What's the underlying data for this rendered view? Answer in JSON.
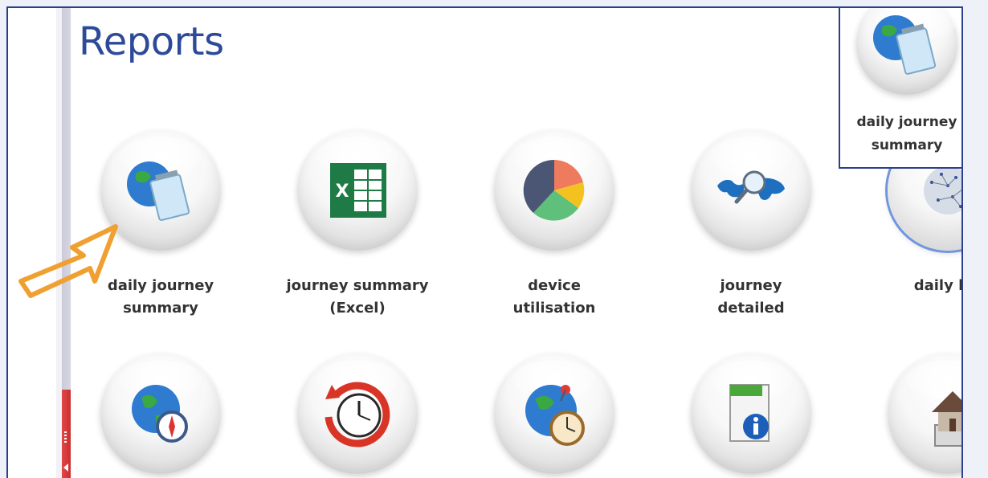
{
  "page": {
    "title": "Reports"
  },
  "reports_row1": [
    {
      "label_line1": "daily journey",
      "label_line2": "summary",
      "icon": "globe-notepad-icon"
    },
    {
      "label_line1": "journey summary",
      "label_line2": "(Excel)",
      "icon": "excel-icon"
    },
    {
      "label_line1": "device",
      "label_line2": "utilisation",
      "icon": "pie-chart-icon"
    },
    {
      "label_line1": "journey",
      "label_line2": "detailed",
      "icon": "world-map-magnifier-icon"
    },
    {
      "label_line1": "daily loc",
      "label_line2": "",
      "icon": "network-globe-icon"
    }
  ],
  "reports_row2": [
    {
      "icon": "globe-compass-icon"
    },
    {
      "icon": "clock-refresh-icon"
    },
    {
      "icon": "globe-pin-clock-icon"
    },
    {
      "icon": "document-info-icon"
    },
    {
      "icon": "house-calculator-icon"
    }
  ],
  "tooltip": {
    "label_line1": "daily journey",
    "label_line2": "summary",
    "icon": "globe-notepad-icon"
  },
  "colors": {
    "title": "#2d4a9a",
    "border": "#2b3f8f",
    "pointer": "#f0a030",
    "selected_ring": "#6f96de"
  }
}
